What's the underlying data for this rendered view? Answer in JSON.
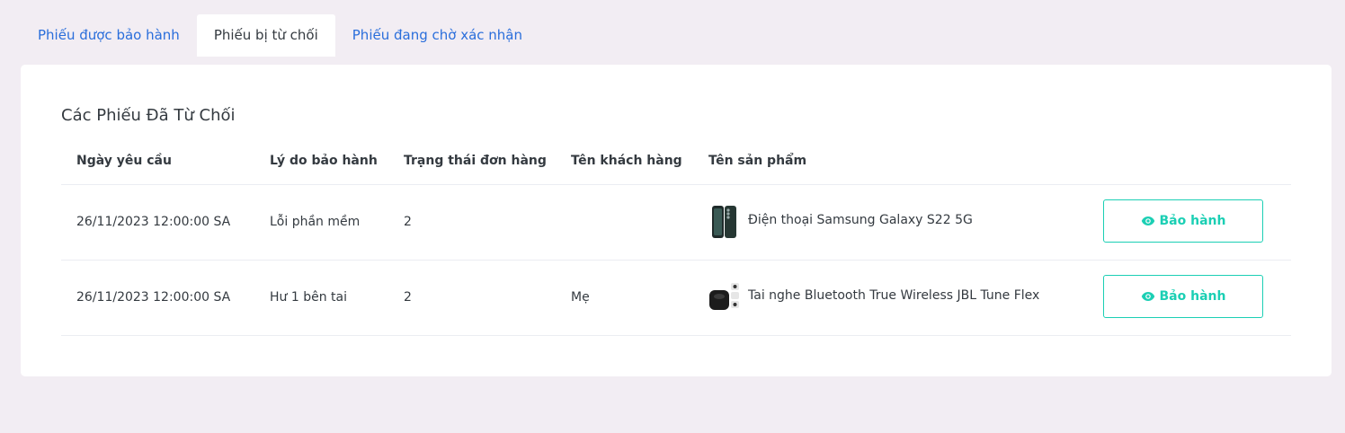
{
  "tabs": [
    {
      "label": "Phiếu được bảo hành",
      "active": false
    },
    {
      "label": "Phiếu bị từ chối",
      "active": true
    },
    {
      "label": "Phiếu đang chờ xác nhận",
      "active": false
    }
  ],
  "card": {
    "title": "Các Phiếu Đã Từ Chối"
  },
  "table": {
    "headers": [
      "Ngày yêu cầu",
      "Lý do bảo hành",
      "Trạng thái đơn hàng",
      "Tên khách hàng",
      "Tên sản phẩm"
    ],
    "rows": [
      {
        "date": "26/11/2023 12:00:00 SA",
        "reason": "Lỗi phần mềm",
        "status": "2",
        "customer": "",
        "product": "Điện thoại Samsung Galaxy S22 5G",
        "product_icon": "phone-thumbnail",
        "action": "Bảo hành"
      },
      {
        "date": "26/11/2023 12:00:00 SA",
        "reason": "Hư 1 bên tai",
        "status": "2",
        "customer": "Mẹ",
        "product": "Tai nghe Bluetooth True Wireless JBL Tune Flex",
        "product_icon": "earbuds-thumbnail",
        "action": "Bảo hành"
      }
    ]
  },
  "colors": {
    "background": "#f2edf3",
    "tab_link": "#2a6edb",
    "accent": "#1bcfb4"
  }
}
